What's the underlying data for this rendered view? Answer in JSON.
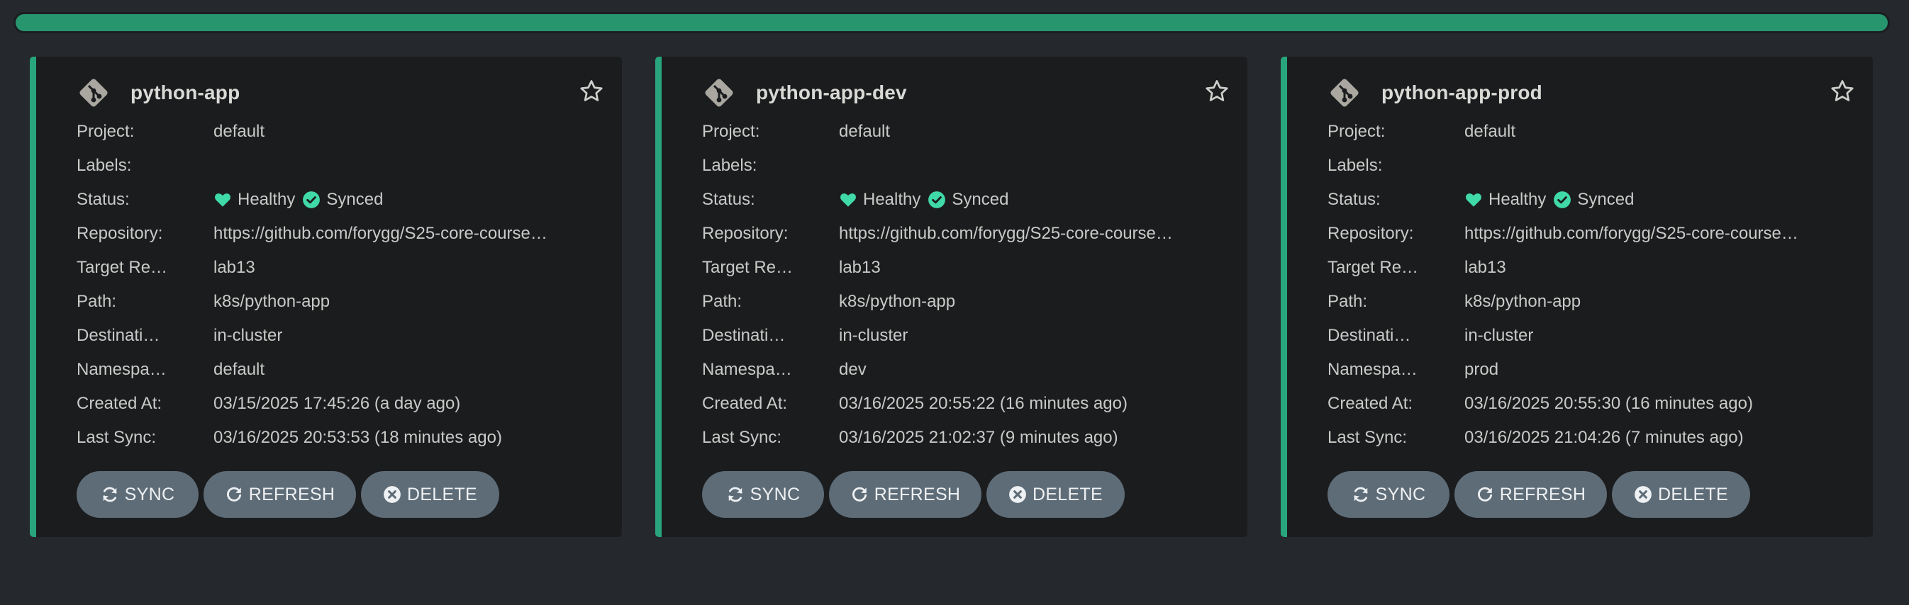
{
  "labels": {
    "project": "Project:",
    "labels": "Labels:",
    "status": "Status:",
    "repository": "Repository:",
    "target_revision": "Target Re…",
    "path": "Path:",
    "destination": "Destinati…",
    "namespace": "Namespa…",
    "created_at": "Created At:",
    "last_sync": "Last Sync:"
  },
  "buttons": {
    "sync": "SYNC",
    "refresh": "REFRESH",
    "delete": "DELETE"
  },
  "colors": {
    "accent": "#28a57c",
    "progress": "#27966f",
    "healthy": "#40d9a8",
    "button": "#5e6c77"
  },
  "icons": {
    "app": "git-icon",
    "favorite": "star-icon",
    "health": "heart-icon",
    "sync_status": "check-circle-icon",
    "sync": "sync-icon",
    "refresh": "refresh-icon",
    "delete": "times-circle-icon"
  },
  "apps": [
    {
      "name": "python-app",
      "project": "default",
      "labels": "",
      "health": "Healthy",
      "sync_status": "Synced",
      "repository": "https://github.com/forygg/S25-core-course…",
      "target_revision": "lab13",
      "path": "k8s/python-app",
      "destination": "in-cluster",
      "namespace": "default",
      "created_at": "03/15/2025 17:45:26  (a day ago)",
      "last_sync": "03/16/2025 20:53:53  (18 minutes ago)"
    },
    {
      "name": "python-app-dev",
      "project": "default",
      "labels": "",
      "health": "Healthy",
      "sync_status": "Synced",
      "repository": "https://github.com/forygg/S25-core-course…",
      "target_revision": "lab13",
      "path": "k8s/python-app",
      "destination": "in-cluster",
      "namespace": "dev",
      "created_at": "03/16/2025 20:55:22  (16 minutes ago)",
      "last_sync": "03/16/2025 21:02:37  (9 minutes ago)"
    },
    {
      "name": "python-app-prod",
      "project": "default",
      "labels": "",
      "health": "Healthy",
      "sync_status": "Synced",
      "repository": "https://github.com/forygg/S25-core-course…",
      "target_revision": "lab13",
      "path": "k8s/python-app",
      "destination": "in-cluster",
      "namespace": "prod",
      "created_at": "03/16/2025 20:55:30  (16 minutes ago)",
      "last_sync": "03/16/2025 21:04:26  (7 minutes ago)"
    }
  ]
}
